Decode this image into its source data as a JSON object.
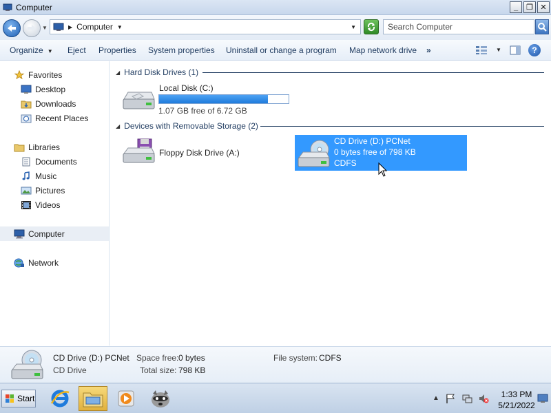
{
  "window": {
    "title": "Computer",
    "minimize": "_",
    "maximize": "❐",
    "close": "✕"
  },
  "address": {
    "crumb": "Computer",
    "search_placeholder": "Search Computer"
  },
  "commands": {
    "organize": "Organize",
    "eject": "Eject",
    "properties": "Properties",
    "system_properties": "System properties",
    "uninstall": "Uninstall or change a program",
    "map_drive": "Map network drive",
    "more": "»"
  },
  "nav": {
    "favorites": "Favorites",
    "desktop": "Desktop",
    "downloads": "Downloads",
    "recent_places": "Recent Places",
    "libraries": "Libraries",
    "documents": "Documents",
    "music": "Music",
    "pictures": "Pictures",
    "videos": "Videos",
    "computer": "Computer",
    "network": "Network"
  },
  "groups": {
    "hard_disk": "Hard Disk Drives (1)",
    "removable": "Devices with Removable Storage (2)"
  },
  "drives": {
    "local_disk": {
      "name": "Local Disk (C:)",
      "free": "1.07 GB free of 6.72 GB",
      "used_fraction": 0.84
    },
    "floppy": {
      "name": "Floppy Disk Drive (A:)"
    },
    "cd": {
      "name": "CD Drive (D:) PCNet",
      "free": "0 bytes free of 798 KB",
      "fs": "CDFS"
    }
  },
  "details": {
    "name": "CD Drive (D:) PCNet",
    "type": "CD Drive",
    "space_free_label": "Space free:",
    "space_free_value": "0 bytes",
    "total_size_label": "Total size:",
    "total_size_value": "798 KB",
    "file_system_label": "File system:",
    "file_system_value": "CDFS"
  },
  "taskbar": {
    "start": "Start",
    "time": "1:33 PM",
    "date": "5/21/2022"
  }
}
